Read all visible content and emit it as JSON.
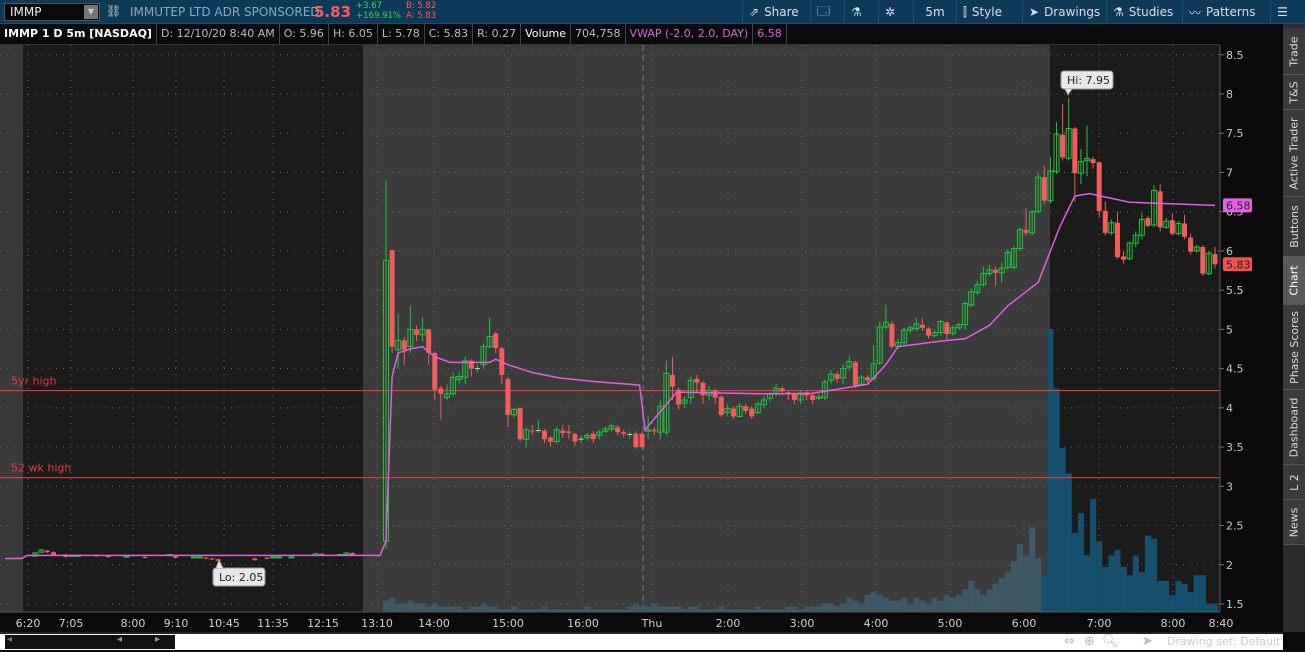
{
  "header": {
    "symbol": "IMMP",
    "company": "IMMUTEP LTD ADR SPONSORED",
    "last": "5.83",
    "change": "+3.67",
    "change_pct": "+169.91%",
    "bid": "B: 5.82",
    "ask": "A: 5.83"
  },
  "toolbar": {
    "share": "Share",
    "timeframe": "5m",
    "style": "Style",
    "drawings": "Drawings",
    "studies": "Studies",
    "patterns": "Patterns"
  },
  "info": {
    "title": "IMMP 1 D 5m [NASDAQ]",
    "date": "D: 12/10/20 8:40 AM",
    "open": "O: 5.96",
    "high": "H: 6.05",
    "low": "L: 5.78",
    "close": "C: 5.83",
    "range": "R: 0.27",
    "volume_label": "Volume",
    "volume": "704,758",
    "vwap_label": "VWAP (-2.0, 2.0, DAY)",
    "vwap": "6.58"
  },
  "side_tabs": [
    "Trade",
    "T&S",
    "Active Trader",
    "Buttons",
    "Chart",
    "Phase Scores",
    "Dashboard",
    "L 2",
    "News"
  ],
  "selected_tab": "Chart",
  "price_axis": [
    1.5,
    2,
    2.5,
    3,
    3.5,
    4,
    4.5,
    5,
    5.5,
    6,
    6.5,
    7,
    7.5,
    8,
    8.5
  ],
  "price_tags": {
    "vwap": "6.58",
    "last": "5.83"
  },
  "time_labels": [
    "6:20",
    "7:05",
    "8:00",
    "9:10",
    "10:45",
    "11:35",
    "12:15",
    "13:10",
    "14:00",
    "15:00",
    "16:00",
    "Thu",
    "2:00",
    "3:00",
    "4:00",
    "5:00",
    "6:00",
    "7:00",
    "8:00",
    "8:40"
  ],
  "levels": [
    {
      "label": "5yr high",
      "price": 4.22
    },
    {
      "label": "52 wk high",
      "price": 3.11
    }
  ],
  "annotations": {
    "hi": "Hi: 7.95",
    "lo": "Lo: 2.05"
  },
  "scrollbar": {
    "drawing_set": "Drawing set: Default"
  },
  "colors": {
    "up": "#1fc43c",
    "down": "#f25c5c",
    "vwap": "#e060e0",
    "volume": "#15506e",
    "level": "#e53b3b"
  },
  "chart_data": {
    "premarket_candles": [
      [
        2,
        2.11,
        2.15
      ],
      [
        3,
        2.16,
        2.19
      ],
      [
        4,
        2.18,
        2.16
      ],
      [
        5,
        2.16,
        2.13
      ],
      [
        7,
        2.13,
        2.1
      ],
      [
        8,
        2.11,
        2.12
      ],
      [
        9,
        2.11,
        2.12
      ],
      [
        12,
        2.12,
        2.11
      ],
      [
        14,
        2.11,
        2.1
      ],
      [
        17,
        2.1,
        2.11
      ],
      [
        20,
        2.1,
        2.09
      ],
      [
        24,
        2.12,
        2.13
      ],
      [
        25,
        2.11,
        2.09
      ],
      [
        28,
        2.09,
        2.1
      ],
      [
        29,
        2.09,
        2.1
      ],
      [
        30,
        2.09,
        2.08
      ],
      [
        31,
        2.08,
        2.07
      ],
      [
        32,
        2.07,
        2.05
      ],
      [
        38,
        2.08,
        2.06
      ],
      [
        40,
        2.09,
        2.08
      ],
      [
        41,
        2.09,
        2.1
      ],
      [
        42,
        2.09,
        2.1
      ],
      [
        44,
        2.09,
        2.1
      ],
      [
        48,
        2.12,
        2.14
      ],
      [
        49,
        2.14,
        2.13
      ],
      [
        52,
        2.12,
        2.13
      ],
      [
        53,
        2.13,
        2.15
      ],
      [
        54,
        2.15,
        2.12
      ]
    ],
    "premarket_vwap": 2.12,
    "candles": [
      [
        2.3,
        5.88,
        6.89,
        2.2
      ],
      [
        6.01,
        4.78,
        6.01,
        4.7
      ],
      [
        4.74,
        4.86,
        5.2,
        4.5
      ],
      [
        4.86,
        4.74,
        4.9,
        4.55
      ],
      [
        4.78,
        5.0,
        5.3,
        4.7
      ],
      [
        5.0,
        4.93,
        5.05,
        4.85
      ],
      [
        4.93,
        5.0,
        5.15,
        4.85
      ],
      [
        5.0,
        4.7,
        5.0,
        4.55
      ],
      [
        4.7,
        4.23,
        4.72,
        4.1
      ],
      [
        4.25,
        4.18,
        4.28,
        3.85
      ],
      [
        4.13,
        4.18,
        4.3,
        4.1
      ],
      [
        4.18,
        4.39,
        4.45,
        4.15
      ],
      [
        4.36,
        4.4,
        4.45,
        4.3
      ],
      [
        4.39,
        4.6,
        4.65,
        4.3
      ],
      [
        4.6,
        4.5,
        4.62,
        4.4
      ],
      [
        4.5,
        4.5,
        4.55,
        4.45
      ],
      [
        4.55,
        4.78,
        4.82,
        4.5
      ],
      [
        4.78,
        4.91,
        5.15,
        4.75
      ],
      [
        4.95,
        4.76,
        4.97,
        4.7
      ],
      [
        4.76,
        4.42,
        4.78,
        4.3
      ],
      [
        4.37,
        3.91,
        4.4,
        3.75
      ],
      [
        3.91,
        3.98,
        4.0,
        3.88
      ],
      [
        4.0,
        3.6,
        4.0,
        3.57
      ],
      [
        3.6,
        3.72,
        3.75,
        3.5
      ],
      [
        3.71,
        3.7,
        3.78,
        3.65
      ],
      [
        3.71,
        3.71,
        3.85,
        3.68
      ],
      [
        3.71,
        3.6,
        3.73,
        3.55
      ],
      [
        3.62,
        3.57,
        3.64,
        3.5
      ],
      [
        3.57,
        3.72,
        3.76,
        3.55
      ],
      [
        3.71,
        3.68,
        3.78,
        3.62
      ],
      [
        3.7,
        3.68,
        3.78,
        3.6
      ],
      [
        3.67,
        3.57,
        3.68,
        3.52
      ],
      [
        3.6,
        3.6,
        3.65,
        3.55
      ],
      [
        3.62,
        3.65,
        3.68,
        3.58
      ],
      [
        3.67,
        3.6,
        3.7,
        3.55
      ],
      [
        3.65,
        3.69,
        3.72,
        3.6
      ],
      [
        3.7,
        3.73,
        3.76,
        3.68
      ],
      [
        3.73,
        3.77,
        3.8,
        3.7
      ],
      [
        3.75,
        3.69,
        3.78,
        3.65
      ],
      [
        3.69,
        3.67,
        3.72,
        3.62
      ],
      [
        3.66,
        3.66,
        3.7,
        3.6
      ],
      [
        3.67,
        3.5,
        3.7,
        3.48
      ],
      [
        3.67,
        3.5,
        3.7,
        3.48
      ],
      [
        3.7,
        3.72,
        3.9,
        3.6
      ],
      [
        3.72,
        3.7,
        3.75,
        3.65
      ],
      [
        3.69,
        4.02,
        4.1,
        3.6
      ],
      [
        3.69,
        4.44,
        4.6,
        3.65
      ],
      [
        4.42,
        4.27,
        4.65,
        4.1
      ],
      [
        4.23,
        4.04,
        4.26,
        3.98
      ],
      [
        4.06,
        4.1,
        4.15,
        4.0
      ],
      [
        4.13,
        4.35,
        4.4,
        4.05
      ],
      [
        4.37,
        4.32,
        4.42,
        4.2
      ],
      [
        4.32,
        4.16,
        4.34,
        4.05
      ],
      [
        4.16,
        4.22,
        4.28,
        4.1
      ],
      [
        4.22,
        4.13,
        4.25,
        4.05
      ],
      [
        4.14,
        3.91,
        4.16,
        3.88
      ],
      [
        3.94,
        3.99,
        4.05,
        3.9
      ],
      [
        3.99,
        3.89,
        4.02,
        3.86
      ],
      [
        3.89,
        4.02,
        4.06,
        3.88
      ],
      [
        4.02,
        3.96,
        4.05,
        3.92
      ],
      [
        3.99,
        3.89,
        4.02,
        3.86
      ],
      [
        3.94,
        4.05,
        4.08,
        3.92
      ],
      [
        4.04,
        4.1,
        4.15,
        4.0
      ],
      [
        4.12,
        4.18,
        4.2,
        4.08
      ],
      [
        4.18,
        4.25,
        4.3,
        4.15
      ],
      [
        4.25,
        4.21,
        4.28,
        4.18
      ],
      [
        4.2,
        4.17,
        4.22,
        4.1
      ],
      [
        4.18,
        4.1,
        4.2,
        4.05
      ],
      [
        4.1,
        4.19,
        4.22,
        4.05
      ],
      [
        4.2,
        4.16,
        4.22,
        4.1
      ],
      [
        4.16,
        4.1,
        4.18,
        4.05
      ],
      [
        4.12,
        4.14,
        4.18,
        4.1
      ],
      [
        4.13,
        4.33,
        4.36,
        4.1
      ],
      [
        4.35,
        4.43,
        4.48,
        4.3
      ],
      [
        4.43,
        4.37,
        4.46,
        4.32
      ],
      [
        4.38,
        4.5,
        4.55,
        4.3
      ],
      [
        4.52,
        4.59,
        4.65,
        4.48
      ],
      [
        4.58,
        4.27,
        4.6,
        4.25
      ],
      [
        4.3,
        4.39,
        4.42,
        4.28
      ],
      [
        4.39,
        4.35,
        4.42,
        4.3
      ],
      [
        4.37,
        4.56,
        4.8,
        4.35
      ],
      [
        4.57,
        5.03,
        5.1,
        4.55
      ],
      [
        5.03,
        5.09,
        5.31,
        5.0
      ],
      [
        5.07,
        4.78,
        5.1,
        4.75
      ],
      [
        4.78,
        4.83,
        4.88,
        4.75
      ],
      [
        4.83,
        4.99,
        5.02,
        4.8
      ],
      [
        4.99,
        5.02,
        5.05,
        4.95
      ],
      [
        5.01,
        5.07,
        5.15,
        4.98
      ],
      [
        5.06,
        5.02,
        5.14,
        4.98
      ],
      [
        5.01,
        4.92,
        5.03,
        4.88
      ],
      [
        4.92,
        4.96,
        5.0,
        4.9
      ],
      [
        4.96,
        5.1,
        5.12,
        4.92
      ],
      [
        5.09,
        4.94,
        5.1,
        4.85
      ],
      [
        4.95,
        5.02,
        5.05,
        4.92
      ],
      [
        5.02,
        5.06,
        5.08,
        5.0
      ],
      [
        5.06,
        5.33,
        5.36,
        5.0
      ],
      [
        5.31,
        5.48,
        5.52,
        5.28
      ],
      [
        5.47,
        5.57,
        5.62,
        5.44
      ],
      [
        5.57,
        5.71,
        5.8,
        5.54
      ],
      [
        5.71,
        5.76,
        5.82,
        5.68
      ],
      [
        5.76,
        5.72,
        5.8,
        5.55
      ],
      [
        5.72,
        5.78,
        5.85,
        5.6
      ],
      [
        5.79,
        5.98,
        6.02,
        5.76
      ],
      [
        5.79,
        6.03,
        6.06,
        5.76
      ],
      [
        6.03,
        6.27,
        6.3,
        6.0
      ],
      [
        6.27,
        6.23,
        6.54,
        6.2
      ],
      [
        6.23,
        6.5,
        6.52,
        6.2
      ],
      [
        6.5,
        6.94,
        7.0,
        6.48
      ],
      [
        6.94,
        6.64,
        7.08,
        6.6
      ],
      [
        6.64,
        7.02,
        7.2,
        6.6
      ],
      [
        7.01,
        7.49,
        7.64,
        6.98
      ],
      [
        7.48,
        7.19,
        7.87,
        7.15
      ],
      [
        7.18,
        7.56,
        7.95,
        7.15
      ],
      [
        7.56,
        6.99,
        7.58,
        6.63
      ],
      [
        6.99,
        7.14,
        7.3,
        6.85
      ],
      [
        7.15,
        7.18,
        7.6,
        6.95
      ],
      [
        7.17,
        7.12,
        7.2,
        7.05
      ],
      [
        7.13,
        6.51,
        7.14,
        6.42
      ],
      [
        6.51,
        6.23,
        6.63,
        6.2
      ],
      [
        6.23,
        6.36,
        6.4,
        6.2
      ],
      [
        6.36,
        5.92,
        6.5,
        5.9
      ],
      [
        5.93,
        5.89,
        6.0,
        5.84
      ],
      [
        5.9,
        6.1,
        6.12,
        5.88
      ],
      [
        6.1,
        6.2,
        6.25,
        6.05
      ],
      [
        6.2,
        6.4,
        6.48,
        6.15
      ],
      [
        6.42,
        6.32,
        6.45,
        6.3
      ],
      [
        6.33,
        6.77,
        6.84,
        6.3
      ],
      [
        6.76,
        6.3,
        6.85,
        6.25
      ],
      [
        6.3,
        6.38,
        6.42,
        6.28
      ],
      [
        6.39,
        6.22,
        6.48,
        6.2
      ],
      [
        6.22,
        6.35,
        6.38,
        6.2
      ],
      [
        6.35,
        6.18,
        6.46,
        6.15
      ],
      [
        6.17,
        5.99,
        6.22,
        5.95
      ],
      [
        6.0,
        6.05,
        6.08,
        5.98
      ],
      [
        6.05,
        5.71,
        6.07,
        5.68
      ],
      [
        5.71,
        5.97,
        6.0,
        5.69
      ],
      [
        5.96,
        5.83,
        6.05,
        5.78
      ]
    ],
    "vwap_knots": [
      [
        0,
        2.3
      ],
      [
        1,
        4.4
      ],
      [
        2,
        4.7
      ],
      [
        4,
        4.75
      ],
      [
        6,
        4.78
      ],
      [
        8,
        4.65
      ],
      [
        10.5,
        4.58
      ],
      [
        17,
        4.58
      ],
      [
        18,
        4.62
      ],
      [
        20,
        4.55
      ],
      [
        24,
        4.45
      ],
      [
        28.5,
        4.38
      ],
      [
        35,
        4.33
      ],
      [
        41.6,
        4.29
      ],
      [
        42.5,
        3.72
      ],
      [
        47.7,
        4.2
      ],
      [
        61,
        4.18
      ],
      [
        69.5,
        4.18
      ],
      [
        79,
        4.3
      ],
      [
        82,
        4.55
      ],
      [
        84,
        4.78
      ],
      [
        91,
        4.85
      ],
      [
        95,
        4.88
      ],
      [
        99,
        5.05
      ],
      [
        102,
        5.3
      ],
      [
        107,
        5.6
      ],
      [
        110.5,
        6.3
      ],
      [
        113,
        6.7
      ],
      [
        115.4,
        6.73
      ],
      [
        122,
        6.62
      ],
      [
        136,
        6.58
      ]
    ],
    "volume_k": [
      4,
      5,
      3,
      3,
      4,
      3,
      3,
      2,
      3,
      2,
      2,
      2,
      2,
      1,
      2,
      2,
      3,
      2,
      2,
      1,
      1,
      2,
      1,
      1,
      1,
      1,
      2,
      1,
      1,
      1,
      1,
      1,
      1,
      2,
      1,
      1,
      1,
      1,
      1,
      1,
      2,
      3,
      2,
      2,
      3,
      2,
      2,
      2,
      2,
      1,
      2,
      2,
      1,
      1,
      1,
      2,
      1,
      1,
      1,
      1,
      1,
      2,
      1,
      1,
      1,
      1,
      2,
      2,
      1,
      2,
      2,
      2,
      3,
      3,
      2,
      3,
      5,
      4,
      3,
      6,
      7,
      6,
      5,
      4,
      4,
      5,
      3,
      5,
      4,
      3,
      5,
      4,
      6,
      5,
      6,
      8,
      11,
      8,
      6,
      8,
      10,
      12,
      14,
      18,
      24,
      20,
      30,
      19,
      13,
      100,
      79,
      58,
      49,
      28,
      35,
      20,
      40,
      25,
      16,
      20,
      22,
      16,
      13,
      20,
      14,
      27,
      26,
      11,
      11,
      6,
      11,
      10,
      7,
      13,
      13,
      3,
      3
    ],
    "y_range": [
      1.5,
      8.5
    ]
  }
}
